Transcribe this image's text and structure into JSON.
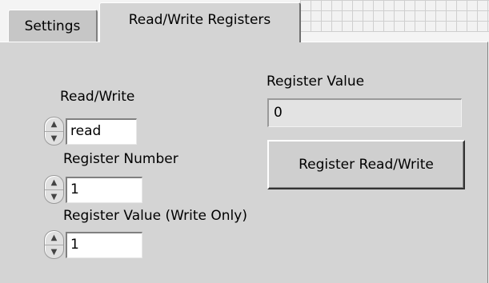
{
  "tabs": [
    {
      "label": "Settings",
      "active": false
    },
    {
      "label": "Read/Write Registers",
      "active": true
    }
  ],
  "controls": {
    "read_write": {
      "label": "Read/Write",
      "value": "read"
    },
    "register_number": {
      "label": "Register Number",
      "value": "1"
    },
    "register_value_write": {
      "label": "Register Value (Write Only)",
      "value": "1"
    }
  },
  "indicator": {
    "label": "Register Value",
    "value": "0"
  },
  "action_button": {
    "label": "Register Read/Write"
  },
  "icons": {
    "spin_up": "increment-arrow",
    "spin_down": "decrement-arrow"
  }
}
